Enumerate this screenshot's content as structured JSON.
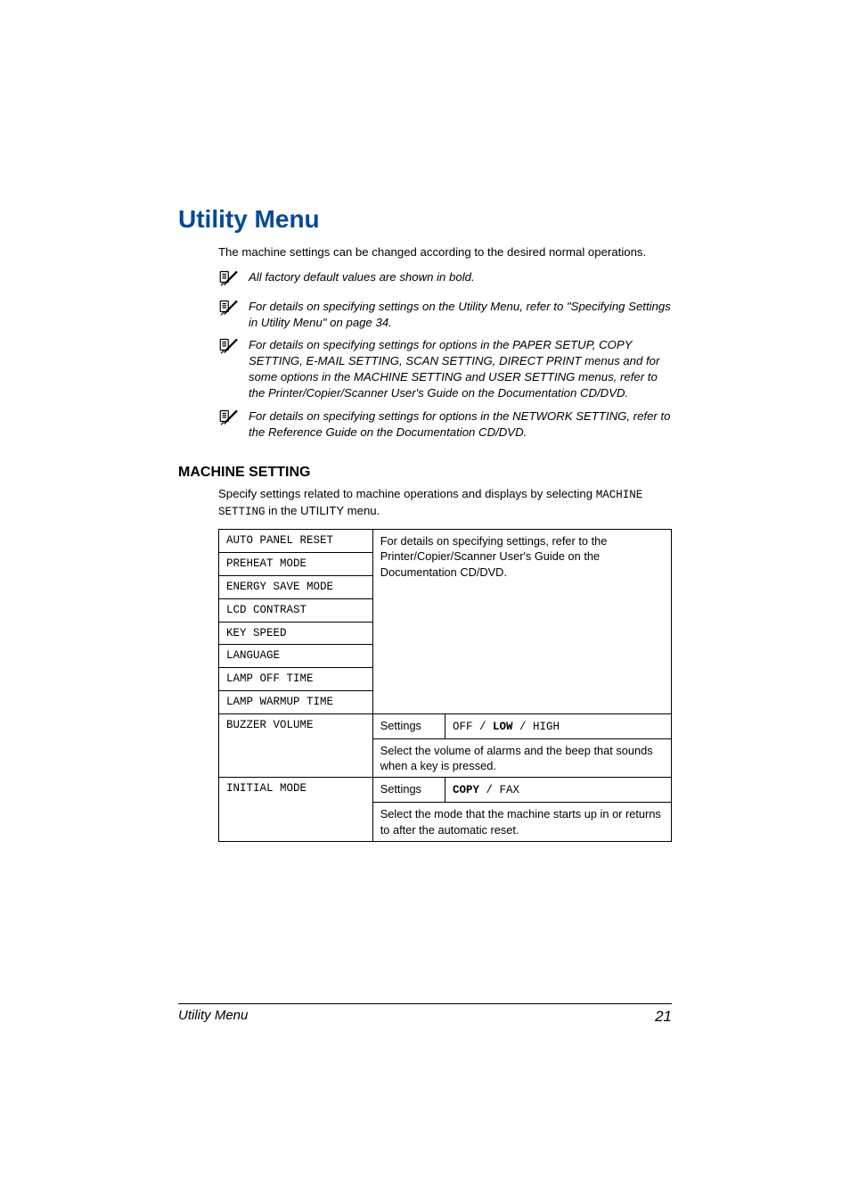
{
  "title": "Utility Menu",
  "intro": "The machine settings can be changed according to the desired normal operations.",
  "notes": [
    "All factory default values are shown in bold.",
    "For details on specifying settings on the Utility Menu, refer to \"Specifying Settings in Utility Menu\" on page 34.",
    "For details on specifying settings for options in the PAPER SETUP, COPY SETTING, E-MAIL SETTING, SCAN SETTING, DIRECT PRINT menus and for some options in the MACHINE SETTING and USER SETTING menus, refer to the Printer/Copier/Scanner User's Guide on the Documentation CD/DVD.",
    "For details on specifying settings for options in the NETWORK SETTING, refer to the Reference Guide on the Documentation CD/DVD."
  ],
  "section": {
    "heading": "MACHINE SETTING",
    "intro_pre": "Specify settings related to machine operations and displays by selecting ",
    "intro_code": "MACHINE SETTING",
    "intro_post": " in the UTILITY menu."
  },
  "table": {
    "passthrough_desc": "For details on specifying settings, refer to the Printer/Copier/Scanner User's Guide on the Documentation CD/DVD.",
    "passthrough_rows": [
      "AUTO PANEL RESET",
      "PREHEAT MODE",
      "ENERGY SAVE MODE",
      "LCD CONTRAST",
      "KEY SPEED",
      "LANGUAGE",
      "LAMP OFF TIME",
      "LAMP WARMUP TIME"
    ],
    "buzzer": {
      "label": "BUZZER VOLUME",
      "settings_label": "Settings",
      "opt_off": "OFF",
      "sep1": " / ",
      "opt_low": "LOW",
      "sep2": " / ",
      "opt_high": "HIGH",
      "desc": "Select the volume of alarms and the beep that sounds when a key is pressed."
    },
    "initial": {
      "label": "INITIAL MODE",
      "settings_label": "Settings",
      "opt_copy": "COPY",
      "sep": " / ",
      "opt_fax": "FAX",
      "desc": "Select the mode that the machine starts up in or returns to after the automatic reset."
    }
  },
  "footer": {
    "left": "Utility Menu",
    "right": "21"
  }
}
